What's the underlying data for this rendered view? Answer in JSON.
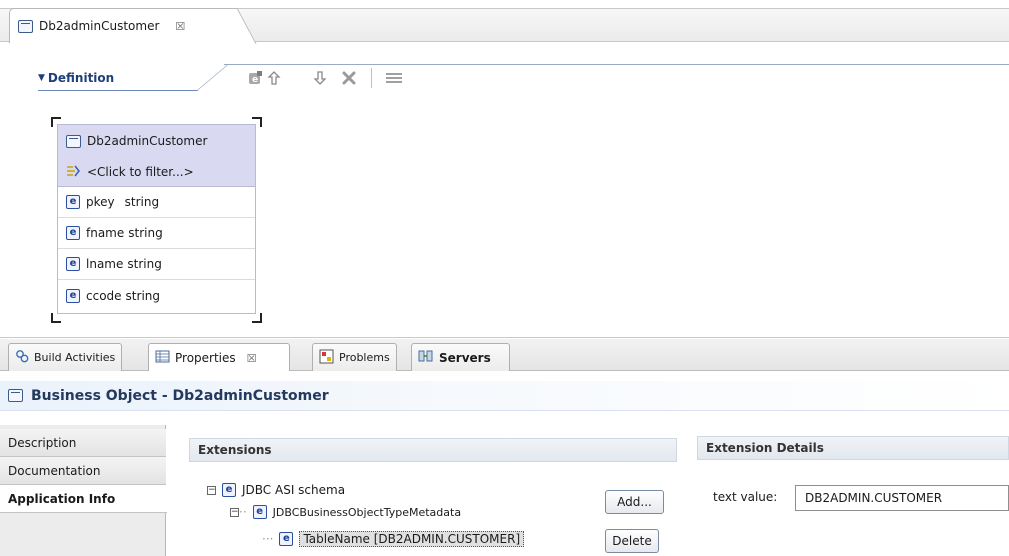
{
  "editor": {
    "tab_label": "Db2adminCustomer",
    "tab_close": "☒",
    "section_label": "Definition"
  },
  "business_object": {
    "name": "Db2adminCustomer",
    "filter_placeholder": "<Click to filter...>",
    "fields": [
      {
        "name": "pkey",
        "type": "string"
      },
      {
        "name": "fname",
        "type": "string"
      },
      {
        "name": "lname",
        "type": "string"
      },
      {
        "name": "ccode",
        "type": "string"
      }
    ]
  },
  "toolbar_icons": [
    "add-attribute-icon",
    "move-up-icon",
    "move-down-icon",
    "delete-icon",
    "layout-icon"
  ],
  "view_tabs": [
    {
      "label": "Build Activities",
      "icon": "build-activities-icon"
    },
    {
      "label": "Properties",
      "icon": "properties-icon",
      "close": "☒"
    },
    {
      "label": "Problems",
      "icon": "problems-icon"
    },
    {
      "label": "Servers",
      "icon": "servers-icon"
    }
  ],
  "properties": {
    "title": "Business Object - Db2adminCustomer",
    "side_tabs": [
      "Description",
      "Documentation",
      "Application Info"
    ],
    "active_side_tab": "Application Info",
    "extensions_header": "Extensions",
    "extension_details_header": "Extension Details",
    "tree": [
      {
        "label": "JDBC ASI schema",
        "level": 0,
        "expander": "⊟"
      },
      {
        "label": "JDBCBusinessObjectTypeMetadata",
        "level": 1,
        "expander": "⊟"
      },
      {
        "label": "TableName [DB2ADMIN.CUSTOMER]",
        "level": 2
      }
    ],
    "add_button": "Add...",
    "delete_button": "Delete",
    "text_value_label": "text value:",
    "text_value": "DB2ADMIN.CUSTOMER"
  }
}
